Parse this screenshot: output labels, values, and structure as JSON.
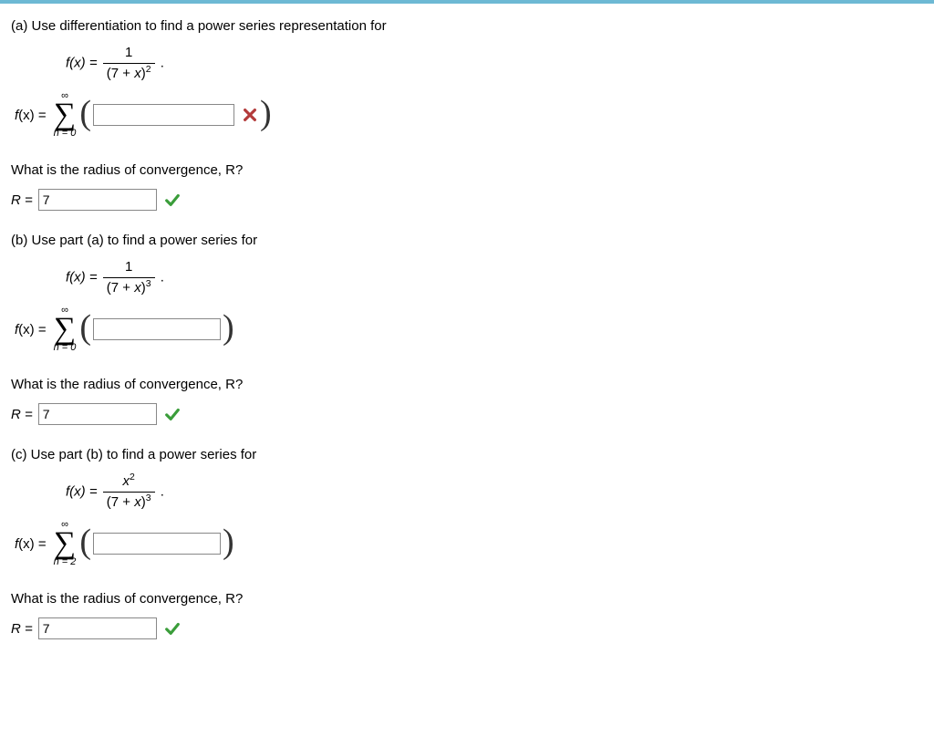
{
  "partA": {
    "prompt": "(a) Use differentiation to find a power series representation for",
    "eq_lhs": "f(x) = ",
    "frac_num": "1",
    "frac_den_pre": "(7 + ",
    "frac_den_var": "x",
    "frac_den_post": ")",
    "frac_den_exp": "2",
    "period": ".",
    "answer_lhs_fx": "f",
    "answer_lhs_x": "(x) = ",
    "sigma_top": "∞",
    "sigma_bottom": "n = 0",
    "input_value": "",
    "status": "incorrect",
    "radius_q": "What is the radius of convergence, R?",
    "radius_lhs": "R = ",
    "radius_value": "7",
    "radius_status": "correct"
  },
  "partB": {
    "prompt": "(b) Use part (a) to find a power series for",
    "eq_lhs": "f(x) = ",
    "frac_num": "1",
    "frac_den_pre": "(7 + ",
    "frac_den_var": "x",
    "frac_den_post": ")",
    "frac_den_exp": "3",
    "period": ".",
    "answer_lhs_fx": "f",
    "answer_lhs_x": "(x) = ",
    "sigma_top": "∞",
    "sigma_bottom": "n = 0",
    "input_value": "",
    "status": "none",
    "radius_q": "What is the radius of convergence, R?",
    "radius_lhs": "R = ",
    "radius_value": "7",
    "radius_status": "correct"
  },
  "partC": {
    "prompt": "(c) Use part (b) to find a power series for",
    "eq_lhs": "f(x) = ",
    "frac_num_var": "x",
    "frac_num_exp": "2",
    "frac_den_pre": "(7 + ",
    "frac_den_var": "x",
    "frac_den_post": ")",
    "frac_den_exp": "3",
    "period": ".",
    "answer_lhs_fx": "f",
    "answer_lhs_x": "(x) = ",
    "sigma_top": "∞",
    "sigma_bottom": "n = 2",
    "input_value": "",
    "status": "none",
    "radius_q": "What is the radius of convergence, R?",
    "radius_lhs": "R = ",
    "radius_value": "7",
    "radius_status": "correct"
  }
}
